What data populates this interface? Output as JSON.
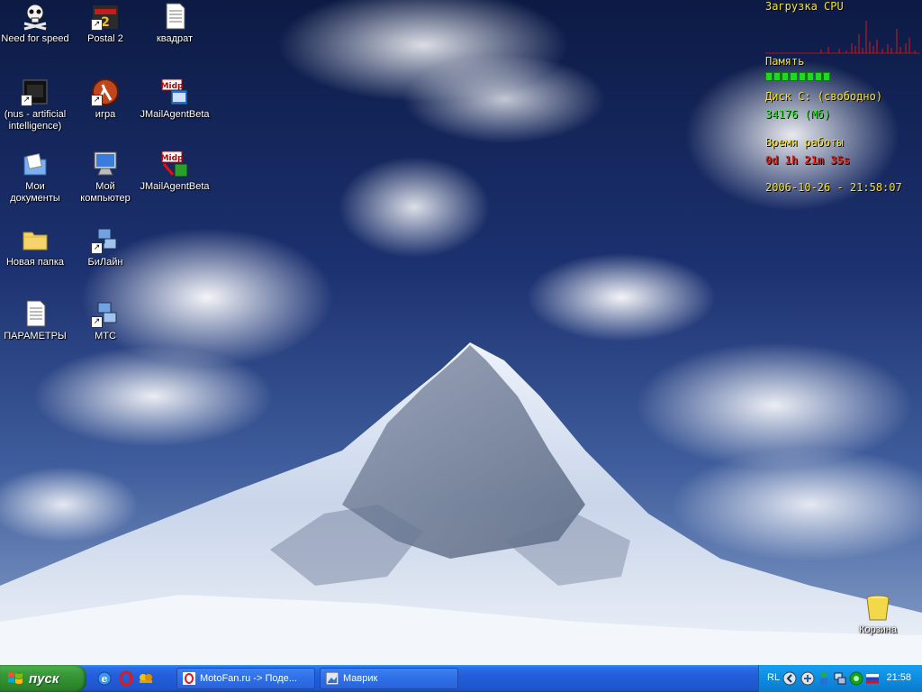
{
  "desktop": {
    "icons": [
      {
        "label": "Need for speed",
        "icon": "skull-icon"
      },
      {
        "label": "Postal 2",
        "icon": "postal2-icon"
      },
      {
        "label": "квадрат",
        "icon": "notepad-document-icon"
      },
      {
        "label": "(nus - artificial intelligence)",
        "icon": "nus-app-icon"
      },
      {
        "label": "игра",
        "icon": "half-life-lambda-icon"
      },
      {
        "label": "JMailAgentBeta",
        "icon": "midp-app-icon"
      },
      {
        "label": "Мои документы",
        "icon": "my-documents-icon"
      },
      {
        "label": "Мой компьютер",
        "icon": "my-computer-icon"
      },
      {
        "label": "JMailAgentBeta",
        "icon": "midp-app-icon"
      },
      {
        "label": "Новая папка",
        "icon": "folder-icon"
      },
      {
        "label": "БиЛайн",
        "icon": "network-connection-icon"
      },
      {
        "label": "ПАРАМЕТРЫ",
        "icon": "notepad-document-icon"
      },
      {
        "label": "МТС",
        "icon": "network-connection-icon"
      },
      {
        "label": "Корзина",
        "icon": "recycle-bin-icon"
      }
    ]
  },
  "monitor": {
    "cpu_label": "Загрузка CPU",
    "memory_label": "Память",
    "disk_label": "Диск С:  (свободно)",
    "disk_value": "34176 (Мб)",
    "uptime_label": "Время работы",
    "uptime_value": "0d 1h 21m 35s",
    "datetime": "2006-10-26 - 21:58:07",
    "colors": {
      "label": "#f4e12a",
      "value": "#33e533",
      "uptime": "#e2231a"
    }
  },
  "taskbar": {
    "start_label": "пуск",
    "quick_launch": [
      "internet-explorer-icon",
      "opera-icon",
      "messenger-icon"
    ],
    "tasks": [
      {
        "label": "MotoFan.ru -> Поде...",
        "icon": "opera-icon"
      },
      {
        "label": "Маврик",
        "icon": "picture-icon"
      }
    ],
    "tray": {
      "language": "RL",
      "clock": "21:58",
      "icons": [
        "chevron-left-icon",
        "sync-icon",
        "person-icon",
        "network-icon",
        "green-circle-icon",
        "russia-flag-icon"
      ]
    }
  }
}
